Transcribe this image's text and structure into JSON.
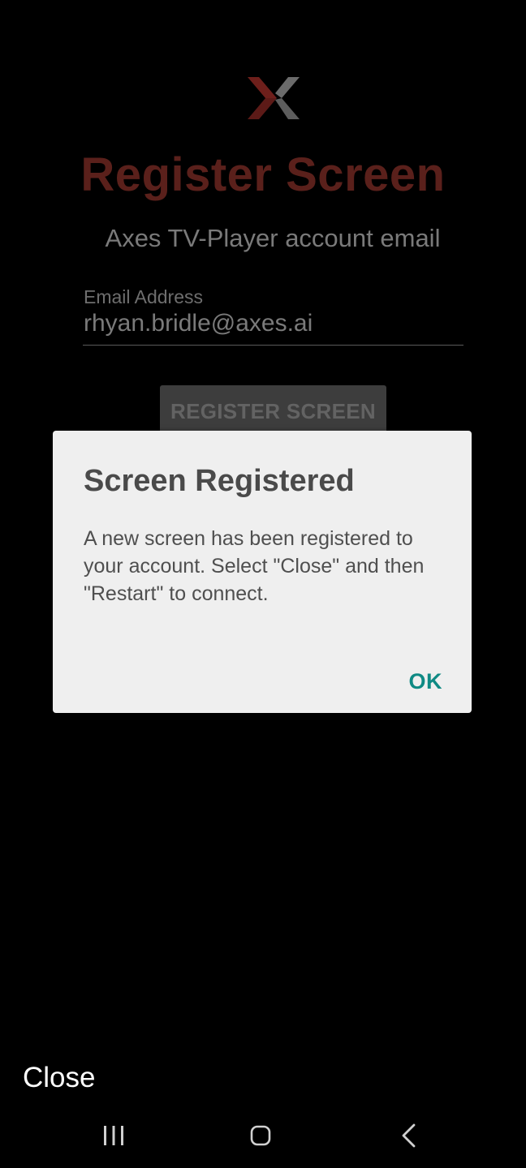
{
  "app": {
    "logo_icon": "axes-x-logo-icon",
    "title": "Register Screen",
    "subtitle": "Axes TV-Player account email",
    "colors": {
      "title": "#5a201b",
      "logo_red": "#6e1f1b",
      "logo_gray": "#6b6b6b"
    }
  },
  "form": {
    "email_label": "Email Address",
    "email_value": "rhyan.bridle@axes.ai",
    "register_button_label": "REGISTER SCREEN"
  },
  "dialog": {
    "title": "Screen Registered",
    "message": "A new screen has been registered to your account. Select \"Close\" and then \"Restart\" to connect.",
    "ok_label": "OK",
    "ok_color": "#0f8a84"
  },
  "bottom": {
    "close_label": "Close"
  },
  "navbar": {
    "recents_icon": "recents-icon",
    "home_icon": "home-icon",
    "back_icon": "back-icon"
  }
}
